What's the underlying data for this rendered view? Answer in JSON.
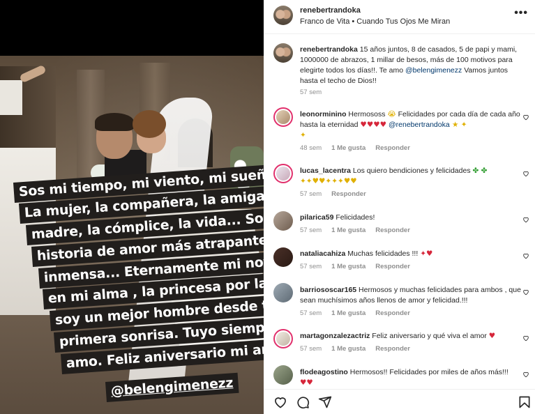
{
  "post": {
    "username": "renebertrandoka",
    "song": "Franco de Vita • Cuando Tus Ojos Me Miran",
    "more_label": "•••"
  },
  "story": {
    "lines": [
      "Sos mi tiempo, mi viento, mi sueño...",
      "La mujer, la compañera, la amiga, la",
      "madre, la cómplice, la vida... Sos la",
      "historia de amor  más atrapante e",
      "inmensa... Eternamente mi novia, y",
      "en mi alma , la princesa por la que",
      "soy un mejor hombre desde tu",
      "primera sonrisa. Tuyo siempre. Te",
      "amo. Feliz aniversario mi amor.",
      "@belengimenezz"
    ]
  },
  "caption": {
    "username": "renebertrandoka",
    "text": " 15 años juntos, 8 de casados, 5 de papi y mami, 1000000 de abrazos, 1 millar de besos, más de 100 motivos para elegirte todos los días!!. Te amo ",
    "mention": "@belengimenezz",
    "text2": " Vamos juntos hasta el techo de Dios!!",
    "time": "57 sem"
  },
  "comments": [
    {
      "username": "leonorminino",
      "text": " Hermososs ",
      "emoji1": "😭",
      "text2": " Felicidades por cada día de cada año hasta la eternidad ",
      "hearts": "♥♥♥♥",
      "mention": " @renebertrandoka",
      "emoji2": " ★ ✦",
      "emoji3": "✦",
      "time": "48 sem",
      "likes": "1 Me gusta",
      "reply": "Responder"
    },
    {
      "username": "lucas_lacentra",
      "text": " Los quiero bendiciones y felicidades ",
      "emoji1": "✤ ✤",
      "emoji2": "✦✦♥♥✦✦✦♥♥",
      "time": "57 sem",
      "likes": "",
      "reply": "Responder"
    },
    {
      "username": "pilarica59",
      "text": " Felicidades!",
      "time": "57 sem",
      "likes": "1 Me gusta",
      "reply": "Responder"
    },
    {
      "username": "nataliacahiza",
      "text": " Muchas felicidades !!! ",
      "emoji1": "✦♥",
      "time": "57 sem",
      "likes": "1 Me gusta",
      "reply": "Responder"
    },
    {
      "username": "barriososcar165",
      "text": " Hermosos y muchas felicidades para ambos , que sean muchísimos años llenos de amor y felicidad.!!!",
      "time": "57 sem",
      "likes": "1 Me gusta",
      "reply": "Responder"
    },
    {
      "username": "martagonzalezactriz",
      "text": " Feliz aniversario y qué viva el amor ",
      "emoji1": "♥",
      "time": "57 sem",
      "likes": "1 Me gusta",
      "reply": "Responder"
    },
    {
      "username": "flodeagostino",
      "text": " Hermosos!! Felicidades por miles de años más!!!",
      "emoji1": "♥♥",
      "time": "",
      "likes": "",
      "reply": ""
    }
  ],
  "icons": {
    "like": "heart-icon",
    "comment": "comment-icon",
    "share": "send-icon",
    "save": "bookmark-icon"
  },
  "colors": {
    "mention": "#00376b",
    "meta": "#8e8e8e",
    "heart": "#d6263a",
    "story_ring": "#e1306c"
  }
}
